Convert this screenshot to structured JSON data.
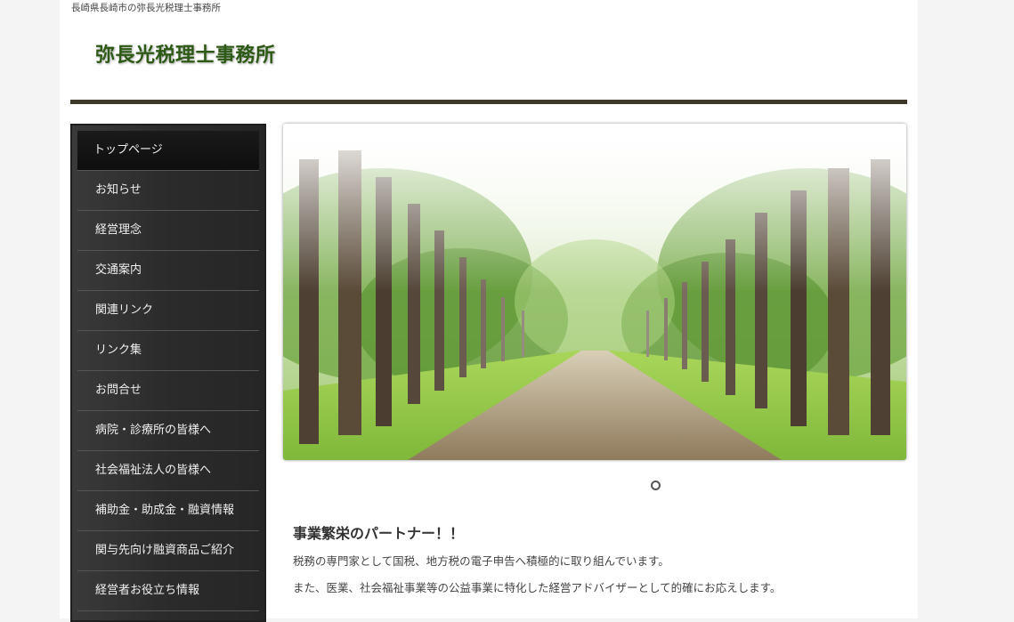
{
  "header": {
    "tagline": "長崎県長崎市の弥長光税理士事務所",
    "site_title": "弥長光税理士事務所"
  },
  "sidebar": {
    "items": [
      {
        "label": "トップページ",
        "active": true
      },
      {
        "label": "お知らせ"
      },
      {
        "label": "経営理念"
      },
      {
        "label": "交通案内"
      },
      {
        "label": "関連リンク"
      },
      {
        "label": "リンク集"
      },
      {
        "label": "お問合せ"
      },
      {
        "label": "病院・診療所の皆様へ"
      },
      {
        "label": "社会福祉法人の皆様へ"
      },
      {
        "label": "補助金・助成金・融資情報"
      },
      {
        "label": "関与先向け融資商品ご紹介"
      },
      {
        "label": "経営者お役立ち情報"
      }
    ]
  },
  "hero": {
    "image": "forest-road-photo",
    "slide_count": 1,
    "active_slide": 1
  },
  "main": {
    "heading": "事業繁栄のパートナー！！",
    "paragraphs": [
      "税務の専門家として国税、地方税の電子申告へ積極的に取り組んでいます。",
      "また、医業、社会福祉事業等の公益事業に特化した経営アドバイザーとして的確にお応えします。"
    ]
  },
  "colors": {
    "title_green": "#2c5a14",
    "header_rule": "#3d3828",
    "sidebar_bg": "#2e2e2e",
    "sidebar_text": "#f0f0f0"
  }
}
